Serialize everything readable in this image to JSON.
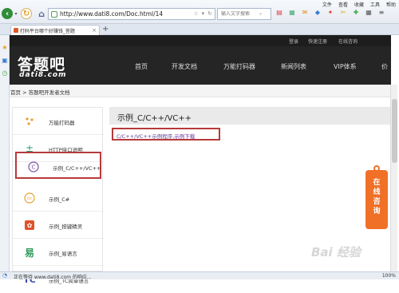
{
  "browser": {
    "menu": [
      "文件",
      "查看",
      "收藏",
      "工具",
      "帮助"
    ],
    "url": "http://www.dati8.com/Doc.html/14",
    "search_placeholder": "输入文字搜索",
    "tab_title": "打码平台哪个好赚钱_答题",
    "status_text": "正在等待 www.dati8.com 的响应...",
    "zoom": "100%"
  },
  "site": {
    "topbar_links": [
      "登录",
      "快速注册",
      "在线咨询"
    ],
    "logo_cn": "答题吧",
    "logo_en": "dati8.com",
    "nav": [
      "首页",
      "开发文档",
      "万能打码器",
      "新闻列表",
      "VIP体系",
      "价"
    ],
    "breadcrumb": "首页 > 答题吧开发者文档"
  },
  "sidebar": {
    "items": [
      {
        "label": "万能打码器",
        "icon": "dots-icon"
      },
      {
        "label": "HTTP接口说明",
        "icon": "plus-minus-icon"
      },
      {
        "label": "示例_C/C++/VC++",
        "icon": "c-circle-icon"
      },
      {
        "label": "示例_C#",
        "icon": "cc-icon"
      },
      {
        "label": "示例_按键精灵",
        "icon": "sprite-icon"
      },
      {
        "label": "示例_易语言",
        "icon": "yi-icon"
      },
      {
        "label": "示例_TC简单语言",
        "icon": "tc-icon"
      }
    ]
  },
  "content": {
    "title": "示例_C/C++/VC++",
    "text": "C/C++/VC++示例程序,",
    "link": "示例下载"
  },
  "float_button": {
    "chars": [
      "在",
      "线",
      "咨",
      "询"
    ]
  },
  "watermark": "Bai 经验",
  "colors": {
    "accent_red": "#b73a3a",
    "orange": "#f07028",
    "dark_nav": "#252525"
  }
}
